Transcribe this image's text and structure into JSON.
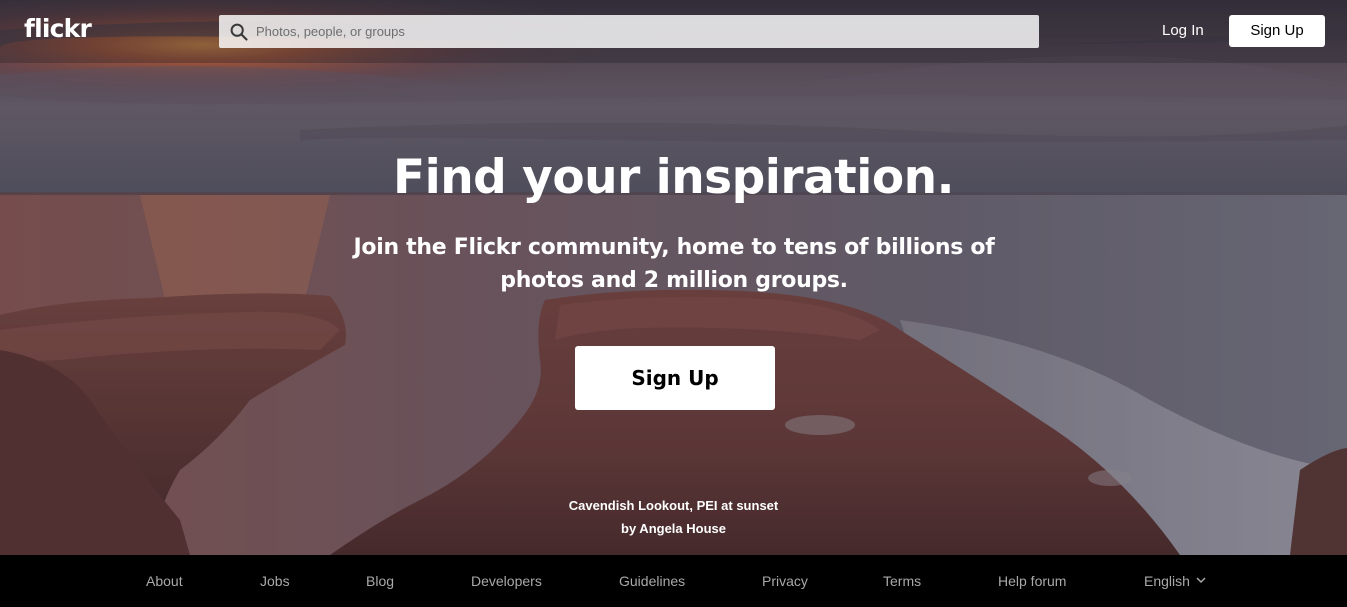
{
  "header": {
    "logo": "flickr",
    "search_placeholder": "Photos, people, or groups",
    "login_label": "Log In",
    "signup_label": "Sign Up"
  },
  "hero": {
    "title": "Find your inspiration.",
    "subtitle": "Join the Flickr community, home to tens of billions of photos and 2 million groups.",
    "cta_label": "Sign Up",
    "photo_title": "Cavendish Lookout, PEI at sunset",
    "photo_author": "by Angela House"
  },
  "footer": {
    "links": [
      "About",
      "Jobs",
      "Blog",
      "Developers",
      "Guidelines",
      "Privacy",
      "Terms",
      "Help forum"
    ],
    "language": "English"
  },
  "icons": {
    "search": "search-icon",
    "language_dropdown": "chevron-down-icon"
  },
  "colors": {
    "footer_bg": "#000000",
    "footer_text": "#a9a9a9",
    "button_bg": "#ffffff"
  }
}
